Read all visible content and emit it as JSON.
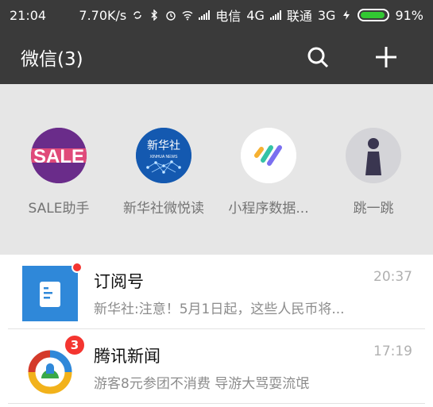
{
  "status_bar": {
    "time": "21:04",
    "net_speed": "7.70K/s",
    "carrier1": "电信",
    "net1": "4G",
    "carrier2": "联通",
    "net2": "3G",
    "battery": "91%",
    "battery_level": 0.91,
    "icons": [
      "sync-icon",
      "bluetooth-icon",
      "alarm-icon",
      "wifi-icon",
      "signal-icon",
      "charging-icon",
      "battery-icon"
    ]
  },
  "header": {
    "title": "微信(3)",
    "icons": [
      "search-icon",
      "plus-icon"
    ]
  },
  "mini_programs": [
    {
      "label": "SALE助手",
      "logo_text": "SALE"
    },
    {
      "label": "新华社微悦读",
      "logo_text": "新华社",
      "logo_subtext": "XINHUA NEWS"
    },
    {
      "label": "小程序数据...",
      "logo_text": ""
    },
    {
      "label": "跳一跳",
      "logo_text": ""
    }
  ],
  "chats": [
    {
      "name": "订阅号",
      "preview": "新华社:注意！5月1日起，这些人民币将...",
      "time": "20:37",
      "unread_dot": true
    },
    {
      "name": "腾讯新闻",
      "preview": "游客8元参团不消费 导游大骂耍流氓",
      "time": "17:19",
      "unread_count": "3"
    }
  ],
  "colors": {
    "header_bg": "#3a3a3a",
    "dropdown_bg": "#e6e6e6",
    "badge_red": "#f43530",
    "subscription_blue": "#2f88d9",
    "battery_green": "#32c832"
  }
}
